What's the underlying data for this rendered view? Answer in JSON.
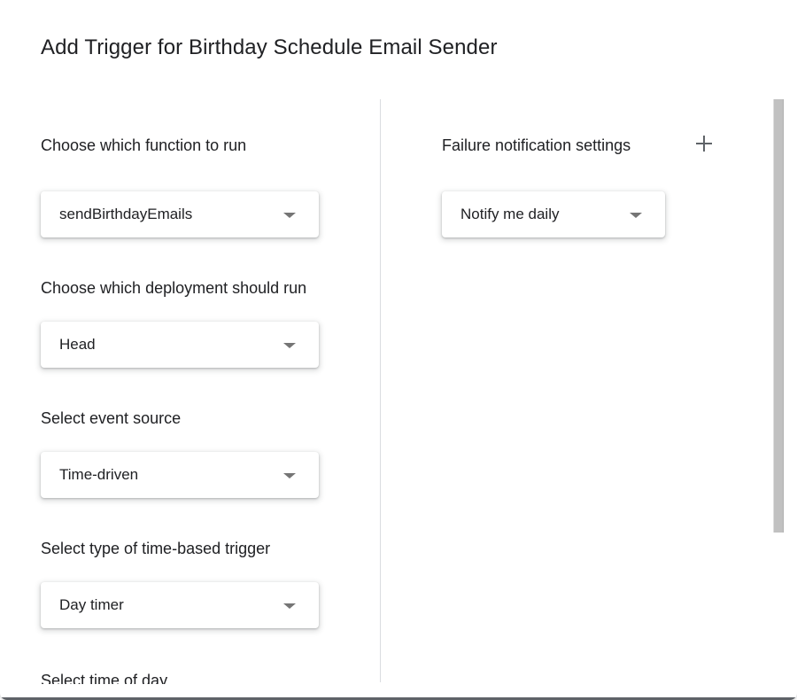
{
  "dialog": {
    "title": "Add Trigger for Birthday Schedule Email Sender"
  },
  "left": {
    "function_label": "Choose which function to run",
    "function_value": "sendBirthdayEmails",
    "deployment_label": "Choose which deployment should run",
    "deployment_value": "Head",
    "event_source_label": "Select event source",
    "event_source_value": "Time-driven",
    "trigger_type_label": "Select type of time-based trigger",
    "trigger_type_value": "Day timer",
    "time_of_day_label": "Select time of day"
  },
  "right": {
    "failure_label": "Failure notification settings",
    "failure_value": "Notify me daily"
  },
  "icons": {
    "add": "plus-icon",
    "dropdown": "triangle-down-icon"
  }
}
